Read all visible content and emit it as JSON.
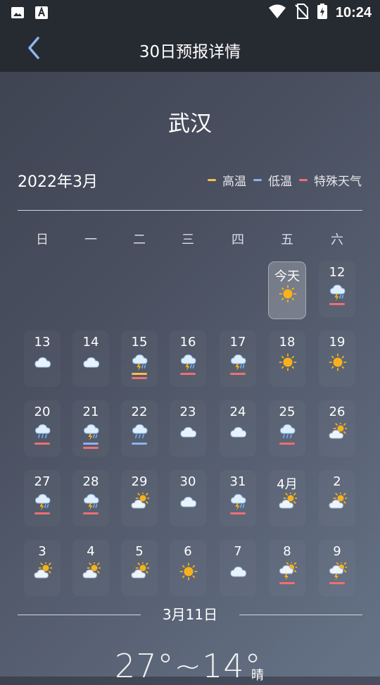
{
  "status_bar": {
    "time": "10:24"
  },
  "app_bar": {
    "title": "30日预报详情"
  },
  "city": "武汉",
  "month_label": "2022年3月",
  "legend": [
    {
      "label": "高温",
      "color": "#f5c04a"
    },
    {
      "label": "低温",
      "color": "#8fb0f7"
    },
    {
      "label": "特殊天气",
      "color": "#ef6f74"
    }
  ],
  "weekdays": [
    "日",
    "一",
    "二",
    "三",
    "四",
    "五",
    "六"
  ],
  "days": [
    {
      "label": "今天",
      "icon": "sun-icon",
      "bars": [],
      "today": true
    },
    {
      "label": "12",
      "icon": "thunder-rain-icon",
      "bars": [
        "special"
      ]
    },
    {
      "label": "13",
      "icon": "cloud-icon",
      "bars": []
    },
    {
      "label": "14",
      "icon": "cloud-icon",
      "bars": []
    },
    {
      "label": "15",
      "icon": "thunder-rain-icon",
      "bars": [
        "high",
        "special"
      ]
    },
    {
      "label": "16",
      "icon": "thunder-rain-icon",
      "bars": [
        "special"
      ]
    },
    {
      "label": "17",
      "icon": "thunder-rain-icon",
      "bars": [
        "special"
      ]
    },
    {
      "label": "18",
      "icon": "sun-icon",
      "bars": []
    },
    {
      "label": "19",
      "icon": "sun-icon",
      "bars": []
    },
    {
      "label": "20",
      "icon": "rain-icon",
      "bars": [
        "special"
      ]
    },
    {
      "label": "21",
      "icon": "thunder-rain-icon",
      "bars": [
        "low",
        "special"
      ]
    },
    {
      "label": "22",
      "icon": "rain-icon",
      "bars": [
        "low"
      ]
    },
    {
      "label": "23",
      "icon": "cloud-icon",
      "bars": []
    },
    {
      "label": "24",
      "icon": "cloud-icon",
      "bars": []
    },
    {
      "label": "25",
      "icon": "rain-icon",
      "bars": [
        "special"
      ]
    },
    {
      "label": "26",
      "icon": "partly-cloudy-icon",
      "bars": []
    },
    {
      "label": "27",
      "icon": "thunder-rain-icon",
      "bars": [
        "special"
      ]
    },
    {
      "label": "28",
      "icon": "thunder-rain-icon",
      "bars": [
        "special"
      ]
    },
    {
      "label": "29",
      "icon": "partly-cloudy-icon",
      "bars": []
    },
    {
      "label": "30",
      "icon": "overcast-icon",
      "bars": []
    },
    {
      "label": "31",
      "icon": "thunder-rain-icon",
      "bars": [
        "special"
      ]
    },
    {
      "label": "4月",
      "icon": "partly-cloudy-icon",
      "bars": []
    },
    {
      "label": "2",
      "icon": "partly-cloudy-icon",
      "bars": []
    },
    {
      "label": "3",
      "icon": "partly-cloudy-icon",
      "bars": []
    },
    {
      "label": "4",
      "icon": "partly-cloudy-icon",
      "bars": []
    },
    {
      "label": "5",
      "icon": "partly-cloudy-icon",
      "bars": []
    },
    {
      "label": "6",
      "icon": "sun-icon",
      "bars": []
    },
    {
      "label": "7",
      "icon": "overcast-icon",
      "bars": []
    },
    {
      "label": "8",
      "icon": "sun-thunder-icon",
      "bars": [
        "special"
      ]
    },
    {
      "label": "9",
      "icon": "sun-thunder-icon",
      "bars": [
        "special"
      ]
    }
  ],
  "first_day_column": 5,
  "selected": {
    "date": "3月11日",
    "temp_range": "27°~14°",
    "condition": "晴"
  }
}
